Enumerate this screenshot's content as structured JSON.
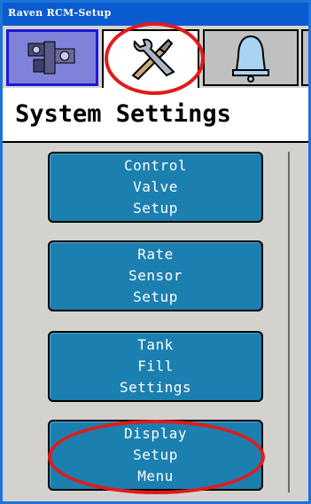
{
  "window": {
    "title": "Raven RCM-Setup"
  },
  "tabs": [
    {
      "icon": "gears-settings-icon",
      "state": "home"
    },
    {
      "icon": "wrench-screwdriver-icon",
      "state": "selected"
    },
    {
      "icon": "bell-icon",
      "state": "normal"
    },
    {
      "icon": "tab-icon",
      "state": "normal"
    }
  ],
  "page": {
    "title": "System Settings"
  },
  "buttons": [
    {
      "lines": [
        "Control",
        "Valve",
        "Setup"
      ]
    },
    {
      "lines": [
        "Rate",
        "Sensor",
        "Setup"
      ]
    },
    {
      "lines": [
        "Tank",
        "Fill",
        "Settings"
      ]
    },
    {
      "lines": [
        "Display",
        "Setup",
        "Menu"
      ]
    }
  ],
  "colors": {
    "titlebar": "#0b5bd0",
    "button": "#1b7fb0",
    "highlight_circle": "#e01b1b",
    "panel": "#d4d2cf"
  }
}
